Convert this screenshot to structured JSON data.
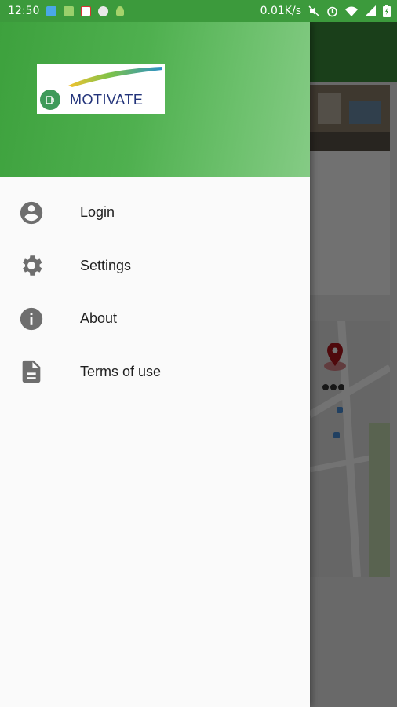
{
  "status_bar": {
    "time": "12:50",
    "network_speed": "0.01K/s",
    "icons": [
      "notification-blue-icon",
      "battery-saver-icon",
      "gmail-icon",
      "chrome-icon",
      "android-icon",
      "mute-icon",
      "alarm-icon",
      "wifi-icon",
      "signal-icon",
      "battery-charging-icon"
    ]
  },
  "drawer": {
    "logo_text": "MOTIVATE",
    "menu": [
      {
        "label": "Login",
        "icon": "account-circle-icon"
      },
      {
        "label": "Settings",
        "icon": "gear-icon"
      },
      {
        "label": "About",
        "icon": "info-icon"
      },
      {
        "label": "Terms of use",
        "icon": "document-icon"
      }
    ]
  },
  "colors": {
    "status_bar": "#3c9a3c",
    "header_gradient_start": "#3da13d",
    "header_gradient_end": "#85cb85",
    "logo_text": "#22337a",
    "icon_gray": "#6e6e6e",
    "map_pin": "#b0161b"
  }
}
